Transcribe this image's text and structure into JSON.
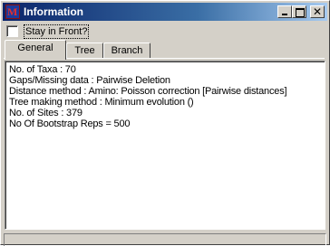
{
  "window": {
    "title": "Information",
    "icon": "app-m-icon",
    "controls": {
      "minimize": "_",
      "maximize": "□",
      "close": "✕"
    }
  },
  "stay_in_front": {
    "label": "Stay in Front?",
    "checked": false
  },
  "tabs": [
    {
      "label": "General",
      "active": true
    },
    {
      "label": "Tree",
      "active": false
    },
    {
      "label": "Branch",
      "active": false
    }
  ],
  "general": {
    "lines": [
      "No. of Taxa : 70",
      "Gaps/Missing data : Pairwise Deletion",
      "Distance method : Amino:  Poisson correction [Pairwise distances]",
      "Tree making method : Minimum evolution ()",
      "No. of Sites : 379",
      "No Of Bootstrap Reps = 500"
    ]
  },
  "colors": {
    "titlebar_start": "#0a246a",
    "titlebar_end": "#a6caf0",
    "face": "#d4d0c8"
  }
}
